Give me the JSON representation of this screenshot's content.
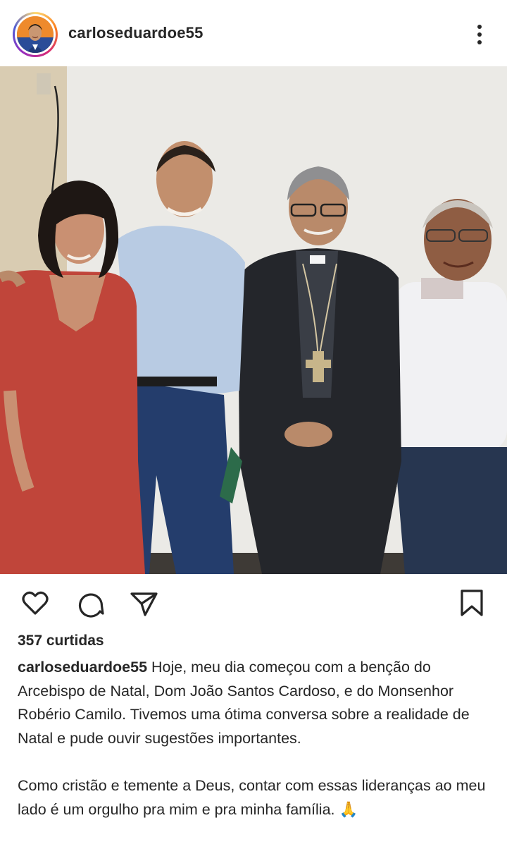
{
  "post": {
    "username": "carloseduardoe55",
    "more_label": "⋮",
    "likes_text": "357 curtidas",
    "caption_paragraph_1": "Hoje, meu dia começou com a benção do Arcebispo de Natal, Dom João Santos Cardoso, e do Monsenhor Robério Camilo. Tivemos uma ótima conversa sobre a realidade de Natal e pude ouvir sugestões importantes.",
    "caption_paragraph_2": "Como cristão e temente a Deus, contar com essas lideranças ao meu lado é um orgulho pra mim e pra minha família. 🙏"
  },
  "icons": {
    "more": "vertical-dots-icon",
    "like": "heart-icon",
    "comment": "comment-bubble-icon",
    "share": "paper-plane-icon",
    "save": "bookmark-icon"
  },
  "colors": {
    "text": "#262626",
    "background": "#ffffff",
    "story_ring": [
      "#feda75",
      "#fa7e1e",
      "#d62976",
      "#962fbf",
      "#4f5bd5"
    ]
  }
}
